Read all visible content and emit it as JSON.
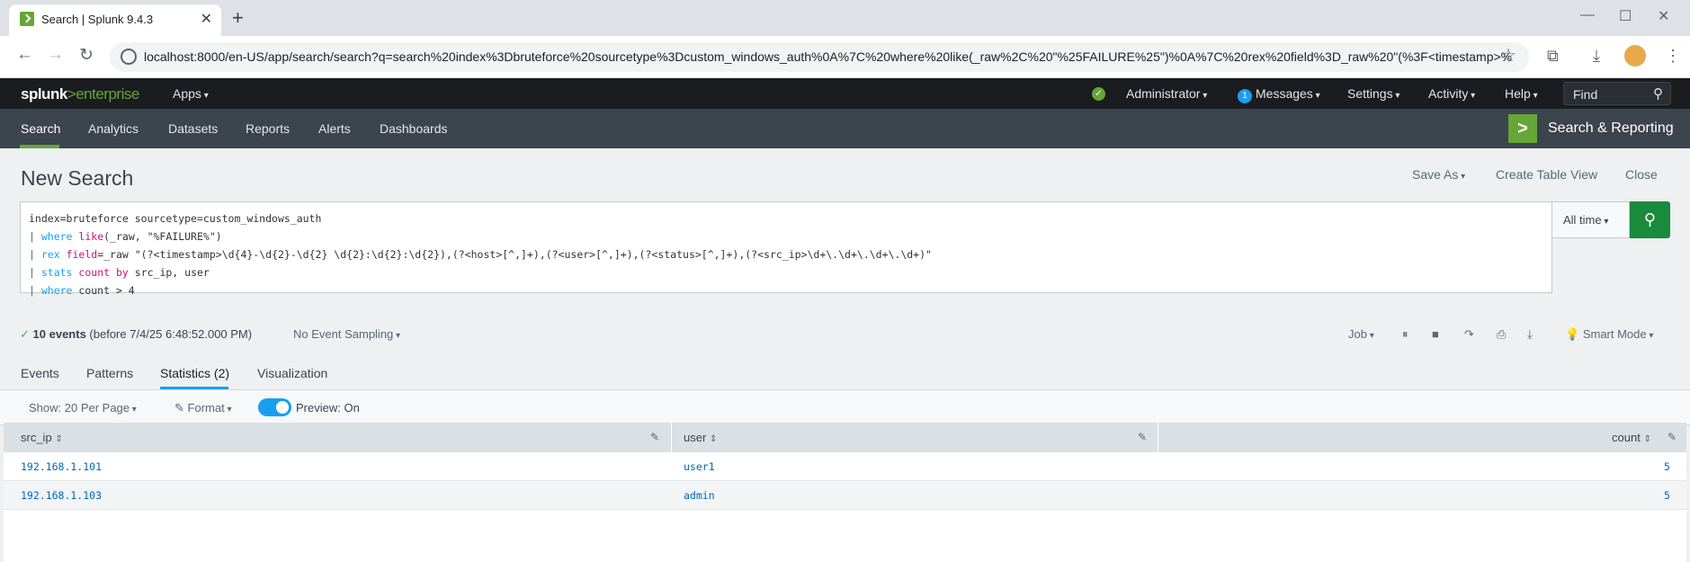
{
  "browser": {
    "tab_title": "Search | Splunk 9.4.3",
    "url": "localhost:8000/en-US/app/search/search?q=search%20index%3Dbruteforce%20sourcetype%3Dcustom_windows_auth%0A%7C%20where%20like(_raw%2C%20\"%25FAILURE%25\")%0A%7C%20rex%20field%3D_raw%20\"(%3F<timestamp>%5C..."
  },
  "splunk_header": {
    "logo_a": "splunk",
    "logo_b": ">enterprise",
    "apps": "Apps",
    "user": "Administrator",
    "messages_count": "1",
    "messages": "Messages",
    "settings": "Settings",
    "activity": "Activity",
    "help": "Help",
    "find": "Find"
  },
  "app_bar": {
    "nav": [
      "Search",
      "Analytics",
      "Datasets",
      "Reports",
      "Alerts",
      "Dashboards"
    ],
    "app_name": "Search & Reporting"
  },
  "page": {
    "title": "New Search",
    "save_as": "Save As",
    "create_table_view": "Create Table View",
    "close": "Close"
  },
  "search": {
    "line1": "index=bruteforce sourcetype=custom_windows_auth",
    "time_range": "All time"
  },
  "status": {
    "events": "10 events",
    "before": "(before 7/4/25 6:48:52.000 PM)",
    "sampling": "No Event Sampling",
    "job": "Job",
    "mode": "Smart Mode"
  },
  "result_tabs": [
    "Events",
    "Patterns",
    "Statistics (2)",
    "Visualization"
  ],
  "options": {
    "show": "Show: 20 Per Page",
    "format": "Format",
    "preview": "Preview: On"
  },
  "table": {
    "columns": [
      "src_ip",
      "user",
      "count"
    ],
    "rows": [
      {
        "src_ip": "192.168.1.101",
        "user": "user1",
        "count": "5"
      },
      {
        "src_ip": "192.168.1.103",
        "user": "admin",
        "count": "5"
      }
    ]
  }
}
